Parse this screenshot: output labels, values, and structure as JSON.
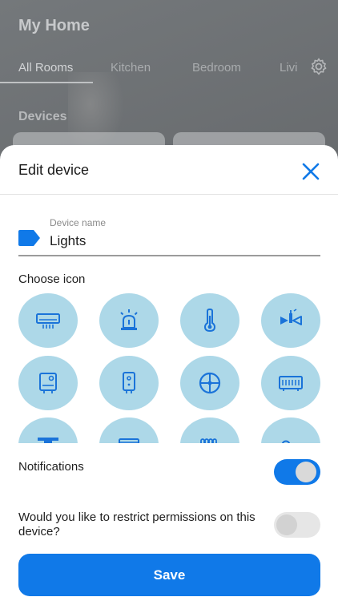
{
  "background": {
    "title": "My Home",
    "tabs": [
      "All Rooms",
      "Kitchen",
      "Bedroom",
      "Livi"
    ],
    "active_tab": "All Rooms",
    "section": "Devices"
  },
  "sheet": {
    "title": "Edit device",
    "device_name_label": "Device name",
    "device_name_value": "Lights",
    "choose_icon_label": "Choose icon",
    "icons": [
      "air-conditioner-icon",
      "siren-icon",
      "thermometer-icon",
      "valve-icon",
      "water-heater-icon",
      "boiler-icon",
      "fan-icon",
      "radiator-display-icon",
      "ceiling-unit-icon",
      "panel-icon",
      "radiator-icon",
      "key-icon"
    ],
    "selected_icon": "air-conditioner-icon",
    "notifications_label": "Notifications",
    "notifications_on": true,
    "permissions_label": "Would you like to restrict permissions on this device?",
    "permissions_on": false,
    "save_label": "Save"
  },
  "colors": {
    "accent": "#1079e8",
    "icon_bg": "#add8e8",
    "icon_fg": "#1a73d9"
  }
}
